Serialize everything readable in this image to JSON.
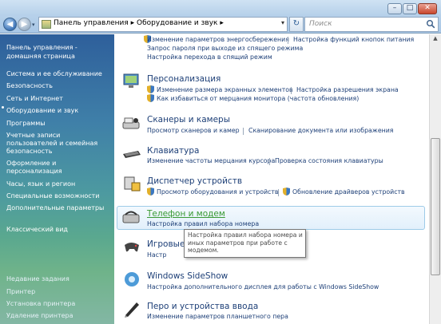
{
  "address": {
    "path": "Панель управления ▸ Оборудование и звук ▸"
  },
  "search": {
    "placeholder": "Поиск"
  },
  "left_nav": {
    "home_line1": "Панель управления -",
    "home_line2": "домашняя страница",
    "items": [
      "Система и ее обслуживание",
      "Безопасность",
      "Сеть и Интернет",
      "Оборудование и звук",
      "Программы",
      "Учетные записи",
      "пользователей и семейная",
      "безопасность",
      "Оформление и",
      "персонализация",
      "Часы, язык и регион",
      "Специальные возможности",
      "Дополнительные параметры"
    ],
    "classic_view": "Классический вид",
    "recent_tasks_title": "Недавние задания",
    "recent_tasks": [
      "Принтер",
      "Установка принтера",
      "Удаление принтера"
    ]
  },
  "power": {
    "links": [
      "Изменение параметров энергосбережения",
      "Настройка функций кнопок питания",
      "Запрос пароля при выходе из спящего режима",
      "Настройка перехода в спящий режим"
    ]
  },
  "personalization": {
    "title": "Персонализация",
    "links": [
      "Изменение размера экранных элементов",
      "Настройка разрешения экрана",
      "Как избавиться от мерцания монитора (частота обновления)"
    ]
  },
  "scanners": {
    "title": "Сканеры и камеры",
    "links": [
      "Просмотр сканеров и камер",
      "Сканирование документа или изображения"
    ]
  },
  "keyboard": {
    "title": "Клавиатура",
    "links": [
      "Изменение частоты мерцания курсора",
      "Проверка состояния клавиатуры"
    ]
  },
  "device_manager": {
    "title": "Диспетчер устройств",
    "links": [
      "Просмотр оборудования и устройств",
      "Обновление драйверов устройств"
    ]
  },
  "phone_modem": {
    "title": "Телефон и модем",
    "links": [
      "Настройка правил набора номера"
    ]
  },
  "game_devices": {
    "title": "Игровые",
    "links": [
      "Настр"
    ]
  },
  "tooltip": {
    "line1": "Настройка правил набора номера и",
    "line2": "иных параметров при работе с",
    "line3": "модемом."
  },
  "sideshow": {
    "title": "Windows SideShow",
    "links": [
      "Настройка дополнительного дисплея для работы с Windows SideShow"
    ]
  },
  "pen_input": {
    "title": "Перо и устройства ввода",
    "links": [
      "Изменение параметров планшетного пера"
    ]
  }
}
